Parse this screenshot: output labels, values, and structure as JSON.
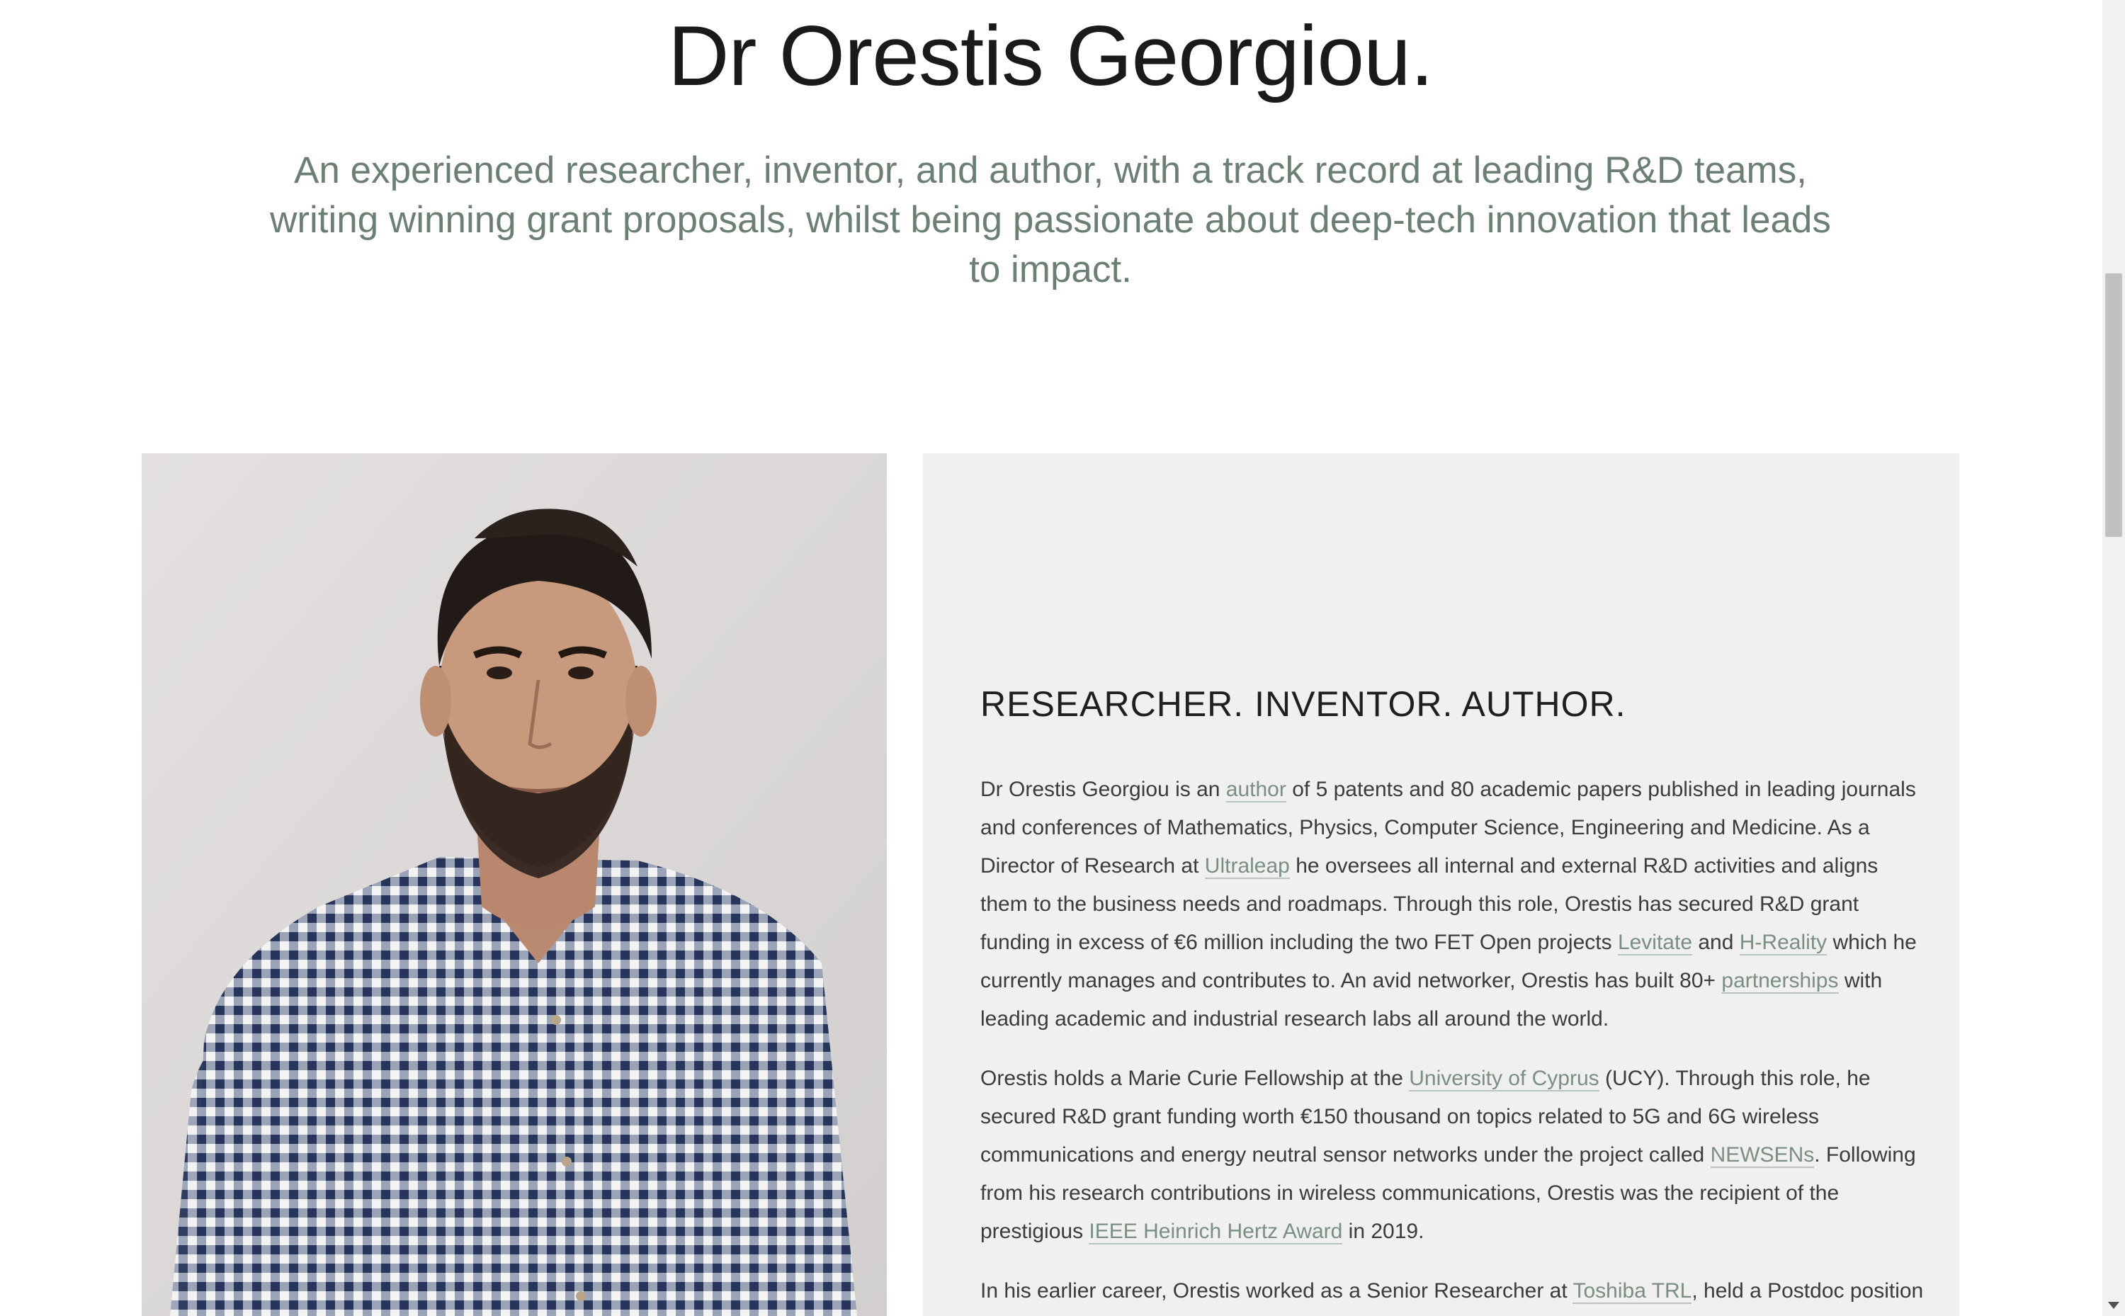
{
  "hero": {
    "title": "Dr Orestis Georgiou.",
    "subtitle": "An experienced researcher, inventor, and author, with a track record at leading R&D teams, writing winning grant proposals, whilst being passionate about deep-tech innovation that leads to impact."
  },
  "portrait": {
    "icon": "person-photo",
    "colors": {
      "background": "#dcd9d8",
      "skin": "#c4967a",
      "hair": "#2a211c",
      "shirt": "#28375c"
    }
  },
  "bio": {
    "heading": "RESEARCHER. INVENTOR. AUTHOR.",
    "p1": {
      "t1": "Dr Orestis Georgiou is an ",
      "link_author": "author",
      "t2": " of 5 patents and 80 academic papers published in leading journals and conferences of Mathematics, Physics, Computer Science, Engineering and Medicine. As a Director of Research at ",
      "link_ultraleap": "Ultraleap",
      "t3": " he oversees all internal and external R&D activities and aligns them to the business needs and roadmaps. Through this role, Orestis has secured R&D grant funding in excess of €6 million including the two FET Open projects ",
      "link_levitate": "Levitate",
      "t4": " and ",
      "link_hreality": "H-Reality",
      "t5": " which he currently manages and contributes to. An avid networker, Orestis has built 80+ ",
      "link_partnerships": "partnerships",
      "t6": " with leading academic and industrial research labs all around the world."
    },
    "p2": {
      "t1": "Orestis holds a Marie Curie Fellowship at the ",
      "link_ucy": "University of Cyprus",
      "t2": " (UCY). Through this role, he secured R&D grant funding worth €150 thousand on topics related to 5G and 6G wireless communications and energy neutral sensor networks under the project called ",
      "link_newsens": "NEWSENs",
      "t3": ". Following from his research contributions in wireless communications, Orestis was the recipient of the prestigious ",
      "link_ieee": "IEEE Heinrich Hertz Award",
      "t4": " in 2019."
    },
    "p3": {
      "t1": "In his earlier career, Orestis worked as a Senior Researcher at ",
      "link_toshiba": "Toshiba TRL",
      "t2": ", held a Postdoc position at"
    }
  },
  "colors": {
    "subtitle": "#6b7f72",
    "link": "#7a8f82",
    "bio_panel_bg": "#eff0ef"
  }
}
